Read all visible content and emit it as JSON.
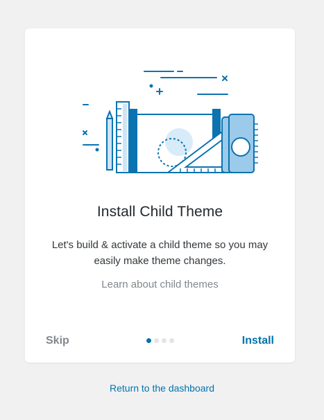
{
  "card": {
    "title": "Install Child Theme",
    "description": "Let's build & activate a child theme so you may easily make theme changes.",
    "learn_link": "Learn about child themes"
  },
  "footer": {
    "skip_label": "Skip",
    "install_label": "Install",
    "steps_total": 4,
    "active_step": 1
  },
  "return_link": "Return to the dashboard",
  "colors": {
    "accent": "#0073aa",
    "muted": "#82878c",
    "illustration_blue": "#0a73b0",
    "illustration_light": "#cfe5f6"
  },
  "icons": {
    "illustration": "child-theme-illustration"
  }
}
